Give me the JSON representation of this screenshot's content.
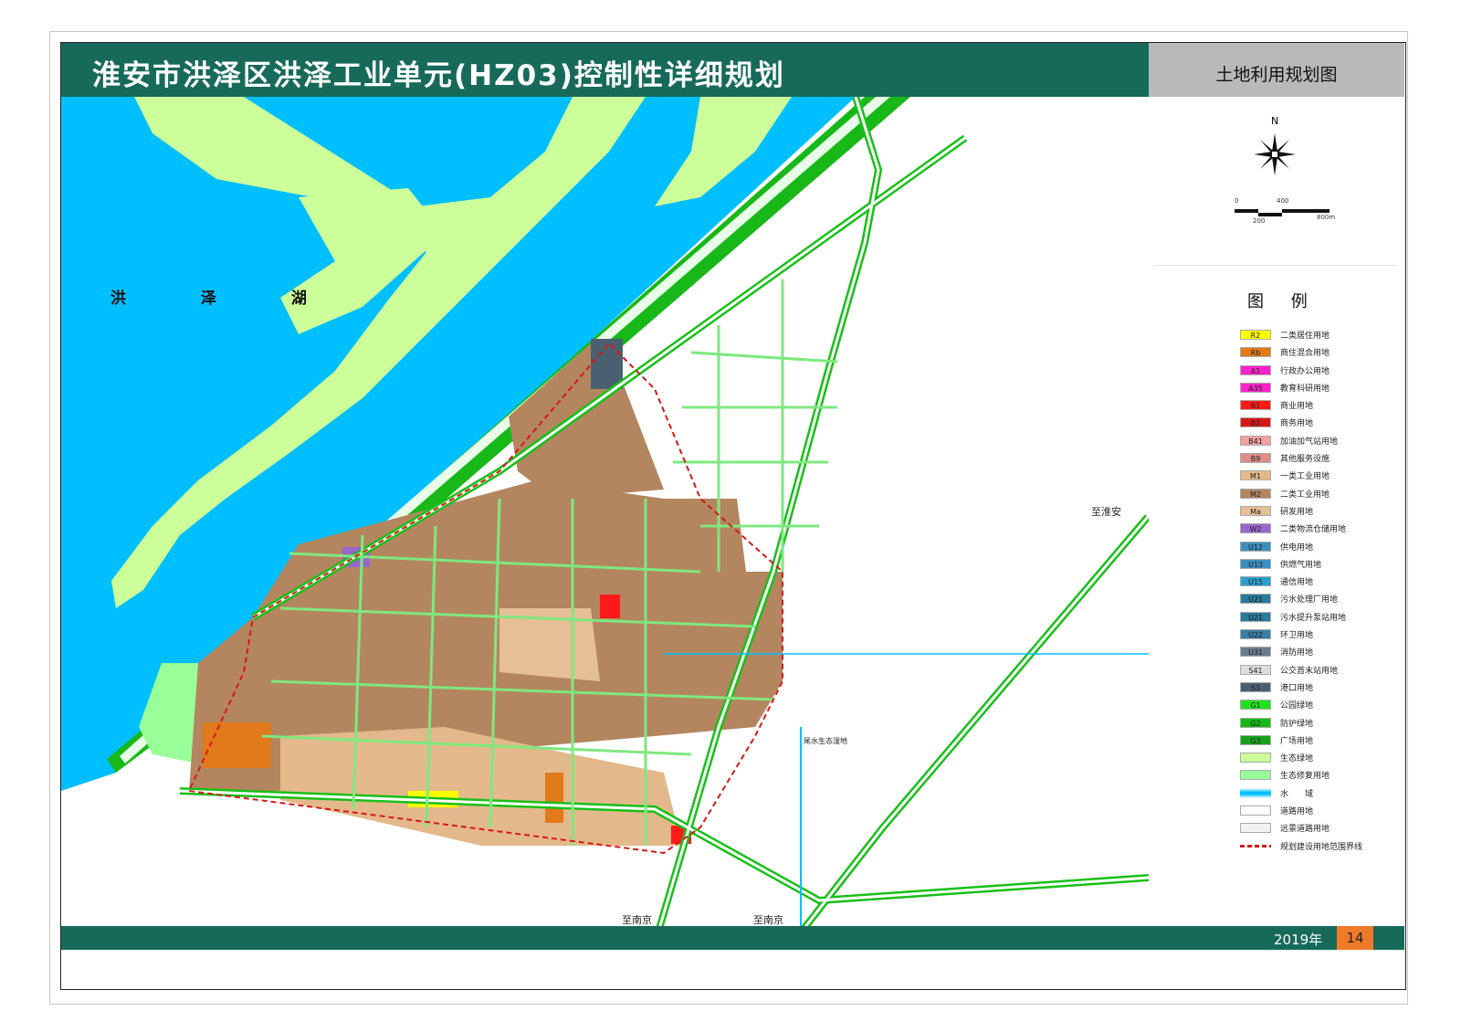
{
  "header": {
    "title": "淮安市洪泽区洪泽工业单元(HZ03)控制性详细规划",
    "panel_title": "土地利用规划图"
  },
  "map": {
    "lake_label": "洪 泽 湖",
    "labels": {
      "to_huaian": "至淮安",
      "to_nanjing_1": "至南京",
      "to_nanjing_2": "至南京",
      "wetland": "尾水生态湿地"
    }
  },
  "compass": {
    "north": "N"
  },
  "scale": {
    "t0": "0",
    "t400": "400",
    "t200": "200",
    "t800": "800m"
  },
  "legend": {
    "title": "图 例",
    "items": [
      {
        "code": "R2",
        "label": "二类居住用地",
        "color": "#ffff00"
      },
      {
        "code": "Rb",
        "label": "商住混合用地",
        "color": "#e07a1a"
      },
      {
        "code": "A1",
        "label": "行政办公用地",
        "color": "#ff22cc"
      },
      {
        "code": "A35",
        "label": "教育科研用地",
        "color": "#ff22cc"
      },
      {
        "code": "B1",
        "label": "商业用地",
        "color": "#ff1a1a"
      },
      {
        "code": "B2",
        "label": "商务用地",
        "color": "#d81818"
      },
      {
        "code": "B41",
        "label": "加油加气站用地",
        "color": "#f2a0a0"
      },
      {
        "code": "B9",
        "label": "其他服务设施",
        "color": "#e08c8c"
      },
      {
        "code": "M1",
        "label": "一类工业用地",
        "color": "#e3b98c"
      },
      {
        "code": "M2",
        "label": "二类工业用地",
        "color": "#b38660"
      },
      {
        "code": "Ma",
        "label": "研发用地",
        "color": "#e6bf96"
      },
      {
        "code": "W2",
        "label": "二类物流仓储用地",
        "color": "#9966cc"
      },
      {
        "code": "U12",
        "label": "供电用地",
        "color": "#3a8fc0"
      },
      {
        "code": "U13",
        "label": "供燃气用地",
        "color": "#3a8fc0"
      },
      {
        "code": "U15",
        "label": "通信用地",
        "color": "#2a9fd0"
      },
      {
        "code": "U21",
        "label": "污水处理厂用地",
        "color": "#2a7a9a"
      },
      {
        "code": "U21",
        "label": "污水提升泵站用地",
        "color": "#2a7a9a"
      },
      {
        "code": "U22",
        "label": "环卫用地",
        "color": "#3a7ea8"
      },
      {
        "code": "U31",
        "label": "消防用地",
        "color": "#6a7a90"
      },
      {
        "code": "S41",
        "label": "公交首末站用地",
        "color": "#dddddd"
      },
      {
        "code": "S3",
        "label": "港口用地",
        "color": "#4a6070"
      },
      {
        "code": "G1",
        "label": "公园绿地",
        "color": "#22e022"
      },
      {
        "code": "G2",
        "label": "防护绿地",
        "color": "#17b817"
      },
      {
        "code": "G3",
        "label": "广场用地",
        "color": "#1aa01a"
      },
      {
        "code": "",
        "label": "生态绿地",
        "color": "#ccff99"
      },
      {
        "code": "",
        "label": "生态修复用地",
        "color": "#99ff99"
      },
      {
        "code": "",
        "label": "水　　域",
        "color": "#00bfff"
      },
      {
        "code": "",
        "label": "道路用地",
        "color": "#ffffff"
      },
      {
        "code": "",
        "label": "远景道路用地",
        "color": "#f2f2f2"
      },
      {
        "code": "",
        "label": "规划建设用地范围界线",
        "color": "#ffffff"
      }
    ]
  },
  "footer": {
    "year": "2019年",
    "page": "14"
  },
  "colors": {
    "title_bar": "#176a5a",
    "water": "#00bfff",
    "eco_green": "#ccff99",
    "industrial": "#b38660",
    "green_belt": "#17b817"
  }
}
